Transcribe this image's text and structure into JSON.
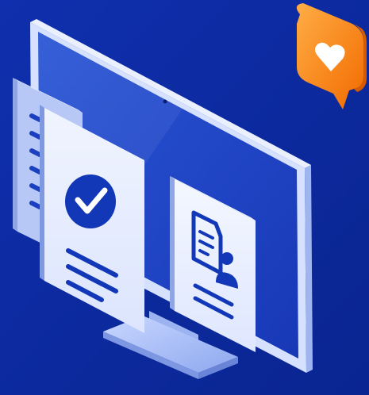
{
  "illustration": {
    "subject": "isometric-desktop-monitor-with-documents",
    "icons": [
      "check-circle-icon",
      "profile-document-icon",
      "heart-icon",
      "list-lines-icon"
    ]
  },
  "colors": {
    "background": "#0c2a9c",
    "monitor_frame": "#cfdcff",
    "monitor_screen": "#1f46c7",
    "card_front": "#eef3ff",
    "card_side": "#aebff2",
    "icon_blue": "#1238b8",
    "badge_orange": "#ff8a1e",
    "badge_orange_dark": "#f36a00",
    "heart": "#ffffff"
  }
}
